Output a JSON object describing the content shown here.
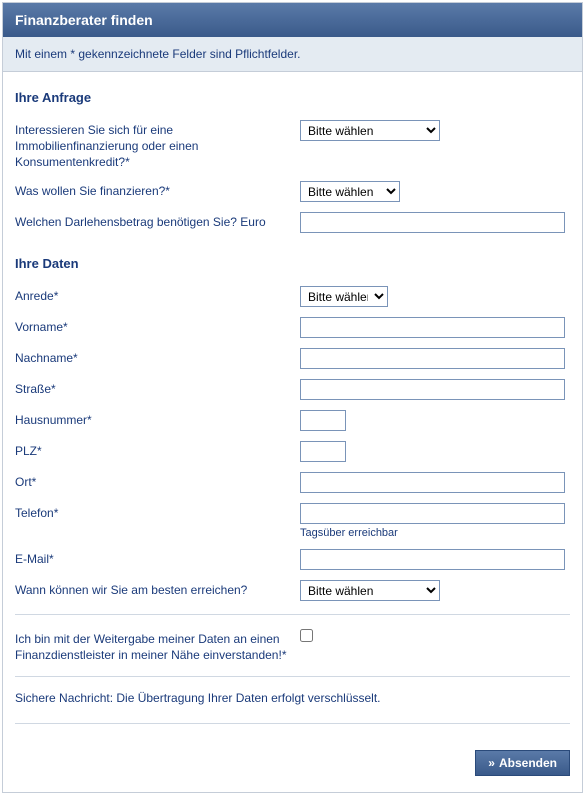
{
  "header": {
    "title": "Finanzberater finden"
  },
  "note": {
    "text": "Mit einem * gekennzeichnete Felder sind Pflichtfelder."
  },
  "sections": {
    "anfrage_heading": "Ihre Anfrage",
    "daten_heading": "Ihre Daten"
  },
  "anfrage": {
    "interesse_label": "Interessieren Sie sich für eine Immobilienfinanzierung oder einen Konsumentenkredit?*",
    "interesse_option": "Bitte wählen",
    "finanzieren_label": "Was wollen Sie finanzieren?*",
    "finanzieren_option": "Bitte wählen",
    "darlehensbetrag_label": "Welchen Darlehensbetrag benötigen Sie? Euro"
  },
  "daten": {
    "anrede_label": "Anrede*",
    "anrede_option": "Bitte wählen",
    "vorname_label": "Vorname*",
    "nachname_label": "Nachname*",
    "strasse_label": "Straße*",
    "hausnummer_label": "Hausnummer*",
    "plz_label": "PLZ*",
    "ort_label": "Ort*",
    "telefon_label": "Telefon*",
    "telefon_hint": "Tagsüber erreichbar",
    "email_label": "E-Mail*",
    "erreichen_label": "Wann können wir Sie am besten erreichen?",
    "erreichen_option": "Bitte wählen"
  },
  "consent": {
    "label": "Ich bin mit der Weitergabe meiner Daten an einen Finanzdienstleister in meiner Nähe einverstanden!*"
  },
  "secure": {
    "text": "Sichere Nachricht: Die Übertragung Ihrer Daten erfolgt verschlüsselt."
  },
  "submit": {
    "arrow": "»",
    "label": "Absenden"
  }
}
